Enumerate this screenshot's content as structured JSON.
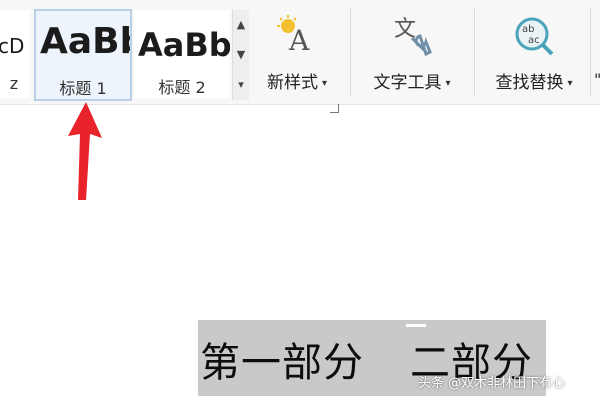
{
  "ribbon": {
    "styles": [
      {
        "preview": "cD",
        "caption": "z"
      },
      {
        "preview": "AaBb",
        "caption": "标题 1"
      },
      {
        "preview": "AaBb(",
        "caption": "标题 2"
      }
    ],
    "new_style": {
      "label": "新样式",
      "icon": "new-style-icon"
    },
    "text_tools": {
      "label": "文字工具",
      "icon": "text-tools-icon"
    },
    "find_replace": {
      "label": "查找替换",
      "icon": "find-replace-icon"
    },
    "edge_item": "\""
  },
  "document": {
    "line_1": "第一部分",
    "line_2": "二部分"
  },
  "watermark": "头条 @双木非林田下有心",
  "colors": {
    "arrow": "#e8232a",
    "selected_style_border": "#b9cfe6",
    "text_highlight": "#c9c9c9"
  }
}
